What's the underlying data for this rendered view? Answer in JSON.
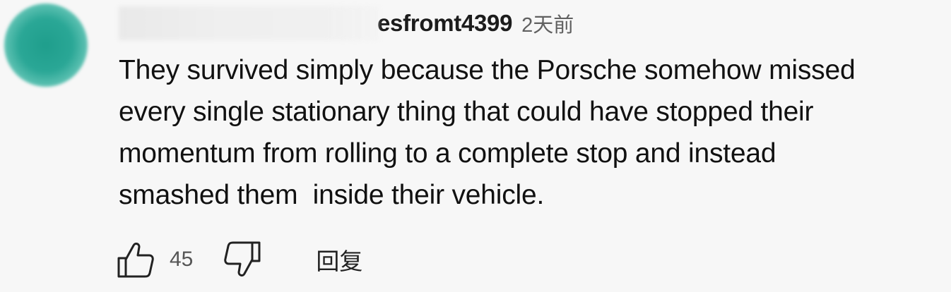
{
  "comment": {
    "author_visible": "esfromt4399",
    "timestamp": "2天前",
    "text": "They survived simply because the Porsche somehow missed\nevery single stationary thing that could have stopped their\nmomentum from rolling to a complete stop and instead\nsmashed them  inside their vehicle.",
    "like_count": "45",
    "reply_label": "回复",
    "avatar_color": "#2aa796",
    "like_icon": "thumbs-up-icon",
    "dislike_icon": "thumbs-down-icon"
  }
}
